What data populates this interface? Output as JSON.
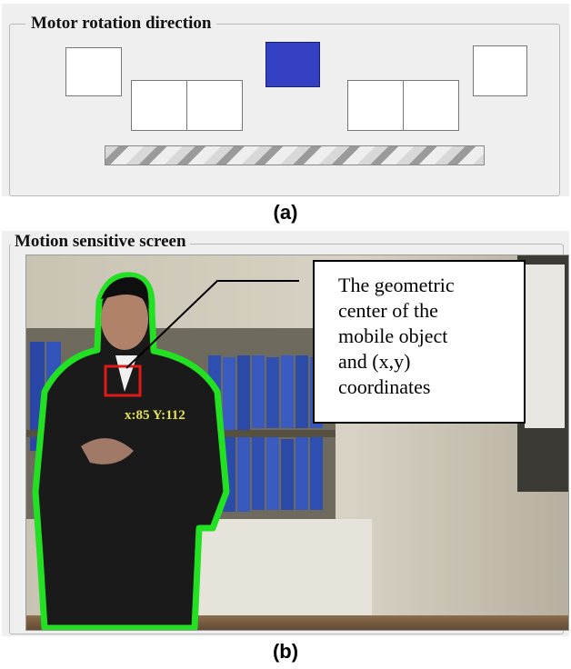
{
  "panel_a": {
    "legend": "Motor rotation direction",
    "caption": "(a)",
    "indicators": [
      {
        "name": "indicator-far-left",
        "active": false
      },
      {
        "name": "indicator-left-2",
        "active": false
      },
      {
        "name": "indicator-left-1",
        "active": false
      },
      {
        "name": "indicator-center",
        "active": true
      },
      {
        "name": "indicator-right-1",
        "active": false
      },
      {
        "name": "indicator-right-2",
        "active": false
      },
      {
        "name": "indicator-far-right",
        "active": false
      }
    ],
    "active_color": "#3340c4"
  },
  "panel_b": {
    "legend": "Motion sensitive screen",
    "caption": "(b)",
    "coordinate_label": "x:85 Y:112",
    "callout_lines": [
      "The geometric",
      "center of the",
      "mobile object",
      "and (x,y)",
      "coordinates"
    ],
    "highlight_color": "#e01818",
    "contour_color": "#22e022"
  }
}
